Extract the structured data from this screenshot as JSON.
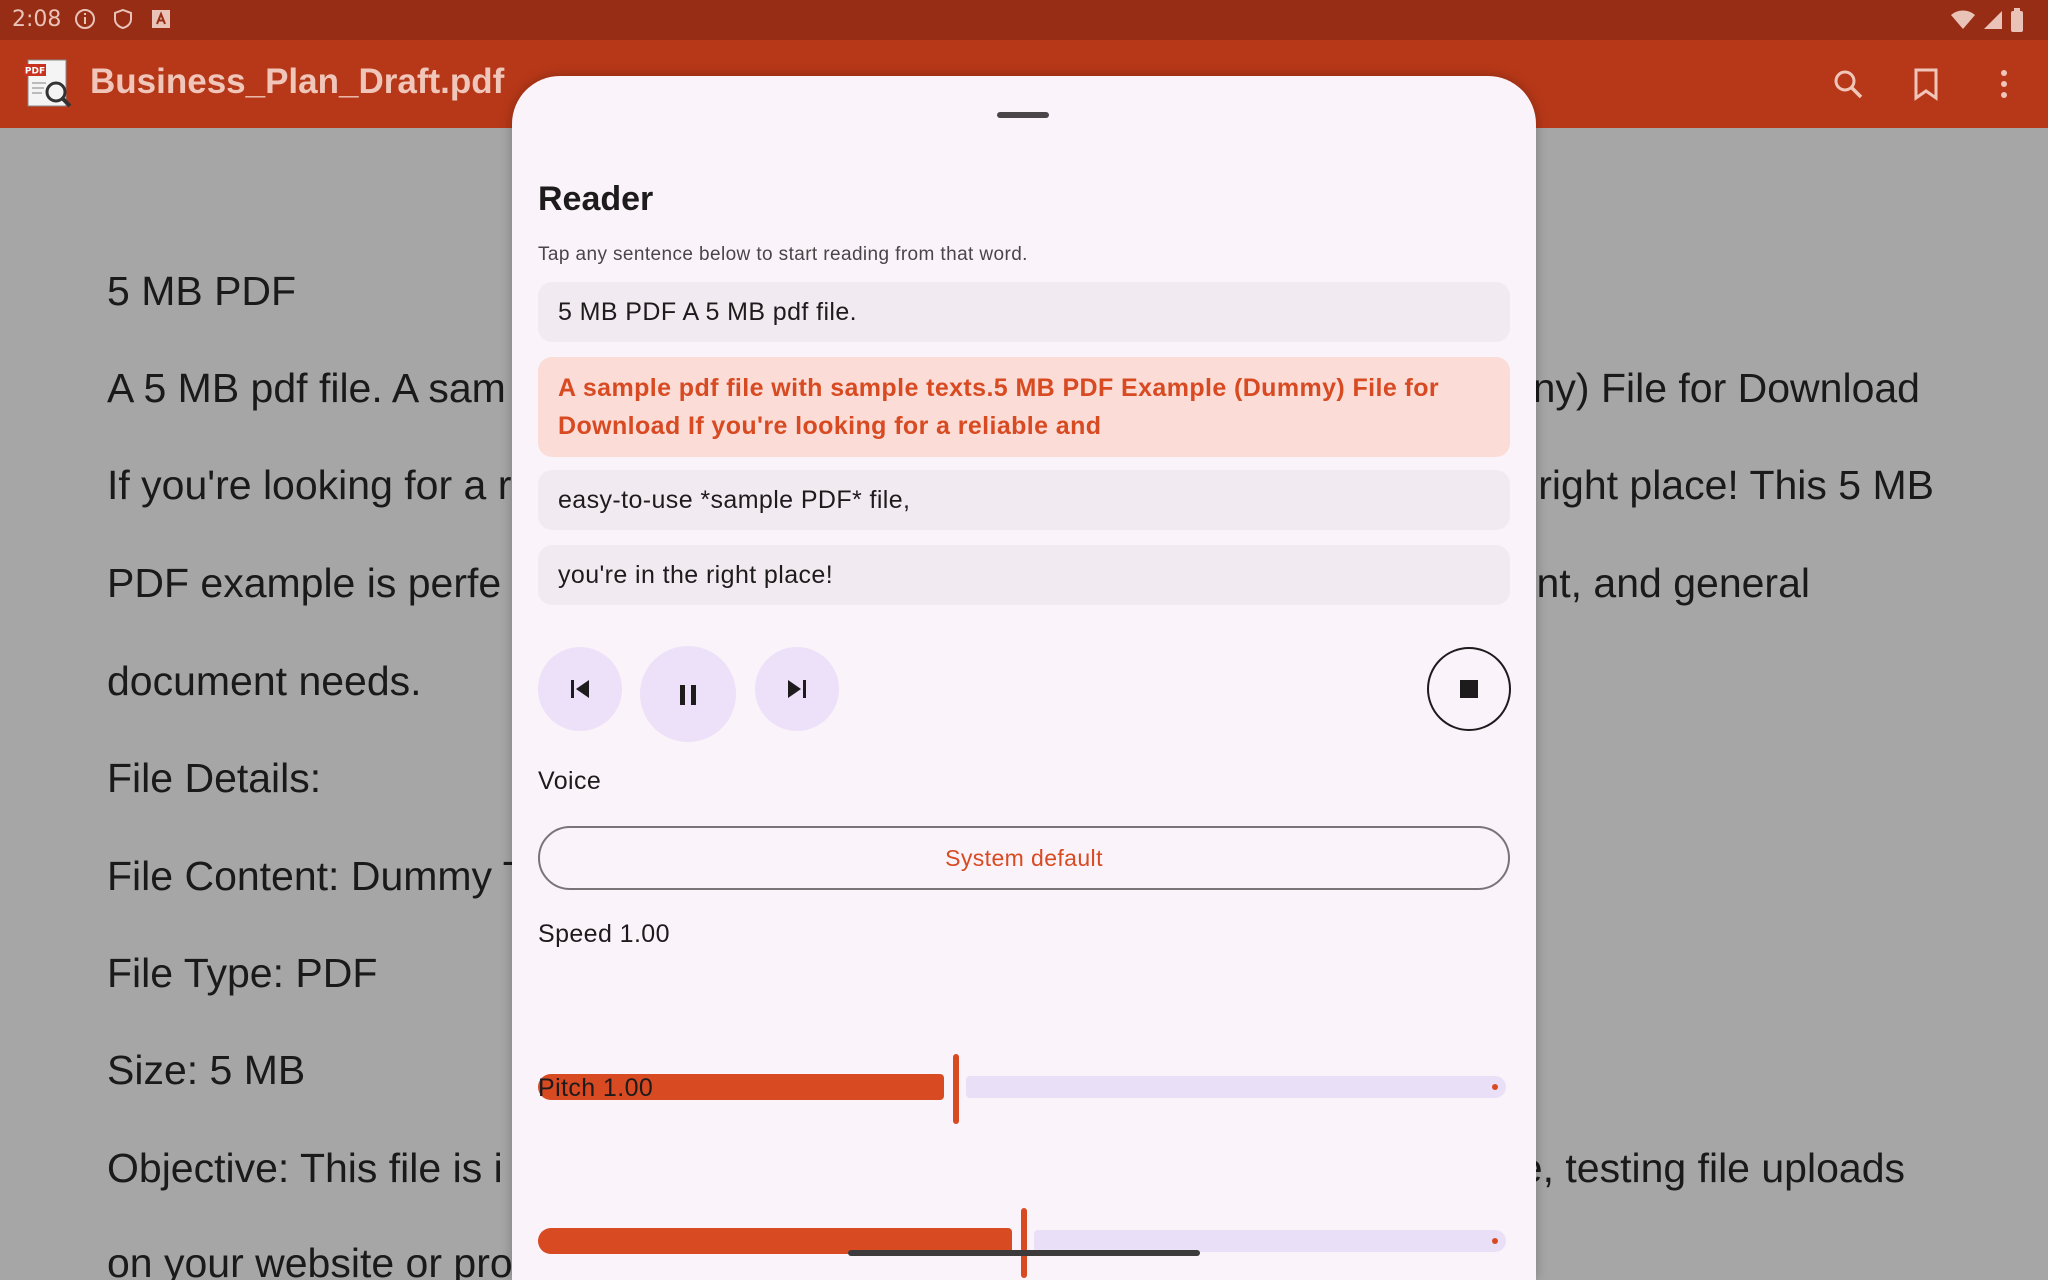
{
  "status_bar": {
    "time": "2:08"
  },
  "app_bar": {
    "title": "Business_Plan_Draft.pdf",
    "logo_text": "PDF"
  },
  "document": {
    "heading": "5 MB PDF",
    "line1_left": "A 5 MB pdf file. A sam",
    "line1_right": "ny) File for Download",
    "line2_left": "If you're looking for a r",
    "line2_right": "right place! This 5 MB",
    "line3_left": "PDF example is perfe",
    "line3_right": "nt, and general",
    "line4": "document needs.",
    "line5": "File Details:",
    "line6": "File Content: Dummy T",
    "line7": "File Type: PDF",
    "line8": "Size: 5 MB",
    "line9_left": "Objective: This file is i",
    "line9_right": "e, testing file uploads",
    "line10": "on your website or pro"
  },
  "reader": {
    "title": "Reader",
    "hint": "Tap any sentence below to start reading from that word.",
    "sentences": [
      "5 MB PDF A 5 MB pdf file.",
      "A sample pdf file with sample texts.5 MB PDF Example (Dummy) File for Download If you're looking for a reliable and",
      "easy-to-use *sample PDF* file,",
      "you're in the right place!"
    ],
    "active_sentence_index": 1,
    "voice_label": "Voice",
    "voice_value": "System default",
    "speed_label": "Speed 1.00",
    "speed_fraction": 0.43,
    "pitch_label": "Pitch 1.00",
    "pitch_fraction": 0.5
  },
  "colors": {
    "accent": "#d84a22",
    "app_bar": "#b73818",
    "status_bar": "#962d14",
    "sheet": "#fbf3fa"
  }
}
